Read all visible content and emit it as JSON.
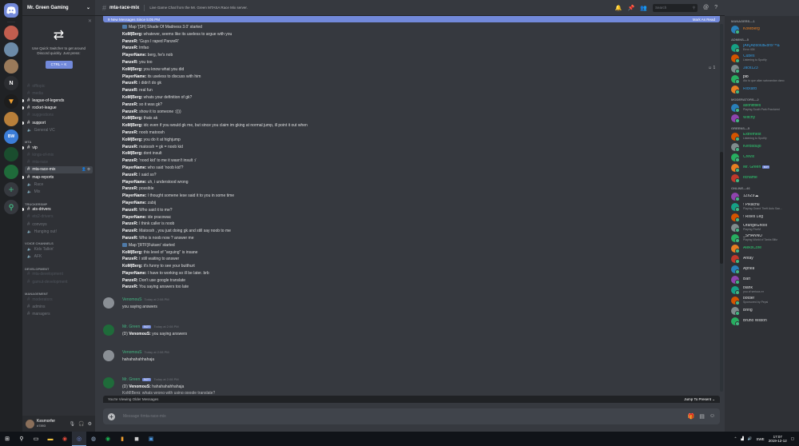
{
  "server": {
    "name": "Mr. Green Gaming",
    "quick_switcher": {
      "text": "Use Quick Switcher to get around Discord quickly. Just press:",
      "shortcut": "CTRL + K"
    }
  },
  "guild_letter": "N",
  "guild_bw": "BW",
  "channels": [
    {
      "type": "channel",
      "name": "offtopic",
      "state": "muted"
    },
    {
      "type": "channel",
      "name": "media",
      "state": "muted"
    },
    {
      "type": "channel",
      "name": "league-of-legends",
      "state": "unread"
    },
    {
      "type": "channel",
      "name": "rocket-league",
      "state": "unread"
    },
    {
      "type": "channel",
      "name": "suggestions",
      "state": "muted"
    },
    {
      "type": "channel",
      "name": "support",
      "state": "unread"
    },
    {
      "type": "voice",
      "name": "General VC",
      "state": "normal"
    },
    {
      "type": "category",
      "name": "MTA"
    },
    {
      "type": "channel",
      "name": "vip",
      "state": "unread"
    },
    {
      "type": "channel",
      "name": "kings-of-mix",
      "state": "muted"
    },
    {
      "type": "channel",
      "name": "mta-race",
      "state": "muted"
    },
    {
      "type": "channel",
      "name": "mta-race-mix",
      "state": "selected"
    },
    {
      "type": "channel",
      "name": "map-reports",
      "state": "unread"
    },
    {
      "type": "voice",
      "name": "Race",
      "state": "normal"
    },
    {
      "type": "voice",
      "name": "Mix",
      "state": "normal"
    },
    {
      "type": "category",
      "name": "TRUCKERSMP"
    },
    {
      "type": "channel",
      "name": "ats-drivers",
      "state": "unread"
    },
    {
      "type": "channel",
      "name": "ets2-drivers",
      "state": "muted"
    },
    {
      "type": "channel",
      "name": "convoys",
      "state": "normal"
    },
    {
      "type": "voice",
      "name": "Hanging out!",
      "state": "normal"
    },
    {
      "type": "category",
      "name": "VOICE CHANNELS"
    },
    {
      "type": "voice",
      "name": "Kids Talkin'",
      "state": "normal"
    },
    {
      "type": "voice",
      "name": "AFK",
      "state": "normal"
    },
    {
      "type": "category",
      "name": "DEVELOPMENT"
    },
    {
      "type": "channel",
      "name": "mta-development",
      "state": "muted"
    },
    {
      "type": "channel",
      "name": "gamut-development",
      "state": "muted"
    },
    {
      "type": "category",
      "name": "MANAGEMENT"
    },
    {
      "type": "channel",
      "name": "moderators",
      "state": "muted"
    },
    {
      "type": "channel",
      "name": "admins",
      "state": "normal"
    },
    {
      "type": "channel",
      "name": "managers",
      "state": "normal"
    }
  ],
  "user": {
    "name": "Kesmorfer",
    "tag": "#7893"
  },
  "chat": {
    "channel": "mta-race-mix",
    "topic": "Live Game Chat from the Mr. Green MTASA Race Mix server.",
    "search_placeholder": "Search",
    "new_messages": "9 New Messages Since 5:05 PM",
    "mark_as_read": "Mark As Read",
    "reaction": "1",
    "log": [
      {
        "emoji": true,
        "author": "",
        "text": "Map '[SH] Shade Of Madness 3.0' started"
      },
      {
        "author": "KoM|Berg:",
        "text": " whatever, seems like its useless to argue with you"
      },
      {
        "author": "PanzeR:",
        "text": " 'Guys I raped PanzeR'"
      },
      {
        "author": "PanzeR:",
        "text": " lmfao"
      },
      {
        "author": "PlayerName:",
        "text": " berg, he's nob"
      },
      {
        "author": "PanzeR:",
        "text": " you too"
      },
      {
        "author": "KoM|Berg:",
        "text": " you know what you did"
      },
      {
        "author": "PlayerName:",
        "text": " its useless to discuss with him"
      },
      {
        "author": "PanzeR:",
        "text": " i didn't do gk"
      },
      {
        "author": "PanzeR:",
        "text": " real fun"
      },
      {
        "author": "KoM|Berg:",
        "text": " whats your definition of gk?"
      },
      {
        "author": "PanzeR:",
        "text": " so it was gk?"
      },
      {
        "author": "PanzeR:",
        "text": " show it to someone :()))"
      },
      {
        "author": "KoM|Berg:",
        "text": " thats ak"
      },
      {
        "author": "KoM|Berg:",
        "text": " idc even if you would gk me, but since you claim im gking at normal jump, ill point it out when"
      },
      {
        "author": "PanzeR:",
        "text": " noob matoosh"
      },
      {
        "author": "KoM|Berg:",
        "text": " you do it at highjump"
      },
      {
        "author": "PanzeR:",
        "text": " matoosh = gk = noob kid"
      },
      {
        "author": "KoM|Berg:",
        "text": " dont insult"
      },
      {
        "author": "PanzeR:",
        "text": " 'nood kid' to me it wasn't insult :/"
      },
      {
        "author": "PlayerName:",
        "text": " who said 'noob kid'?"
      },
      {
        "author": "PanzeR:",
        "text": " I said so?"
      },
      {
        "author": "PlayerName:",
        "text": " uh, i understood wrong"
      },
      {
        "author": "PanzeR:",
        "text": " possible"
      },
      {
        "author": "PlayerName:",
        "text": " I thought somene lese said it to you in some time"
      },
      {
        "author": "PlayerName:",
        "text": " zabij"
      },
      {
        "author": "PanzeR:",
        "text": " Who said it to me?"
      },
      {
        "author": "PlayerName:",
        "text": " ide pracowac"
      },
      {
        "author": "PanzeR:",
        "text": " I think caller is noob"
      },
      {
        "author": "PanzeR:",
        "text": " Matoosh , you just doing gk and still say noob to me"
      },
      {
        "author": "PanzeR:",
        "text": " Who is noob now ? answer me"
      },
      {
        "emoji": true,
        "author": "",
        "text": "Map '[RTF]Fukaro' started"
      },
      {
        "author": "KoM|Berg:",
        "text": " this level of \"arguing\" is insane"
      },
      {
        "author": "PanzeR:",
        "text": " I still waiting to answer"
      },
      {
        "author": "KoM|Berg:",
        "text": " it's funny to see your butthurt"
      },
      {
        "author": "PlayerName:",
        "text": " I have to working so ill be later. brb"
      },
      {
        "author": "PanzeR:",
        "text": " Don't use google translate"
      },
      {
        "author": "PanzeR:",
        "text": " You saying answers too late"
      }
    ],
    "messages": [
      {
        "name": "VenomouS",
        "time": "Today at 2:08 PM",
        "body": "you saying answers"
      },
      {
        "name": "Mr. Green",
        "bot": "BOT",
        "time": "Today at 2:08 PM",
        "body_prefix": "(D) ",
        "body_author": "VenomouS:",
        "body": " you saying answers"
      },
      {
        "name": "VenomouS",
        "time": "Today at 2:08 PM",
        "body": "hahahahahhahaja"
      },
      {
        "name": "Mr. Green",
        "bot": "BOT",
        "time": "Today at 2:08 PM",
        "body_prefix": "(D) ",
        "body_author": "VenomouS:",
        "body": " hahahahahhahaja",
        "body2": "KoM|Berg: whats wrong with using google translate?"
      }
    ],
    "older_messages": "You're Viewing Older Messages",
    "jump_to_present": "Jump To Present",
    "composer_placeholder": "Message #mta-race-mix"
  },
  "members": [
    {
      "type": "category",
      "label": "MANAGERS—1"
    },
    {
      "name": "KoMBerg",
      "color": "#e67e22",
      "status": ""
    },
    {
      "type": "category",
      "label": "ADMINS—5"
    },
    {
      "name": "[AK]AbsolutEbrix™&",
      "color": "#3498db",
      "status": "Error 404"
    },
    {
      "name": "Cubes",
      "color": "#3498db",
      "status": "Listening to Spotify"
    },
    {
      "name": "Jack123",
      "color": "#3498db",
      "status": ""
    },
    {
      "name": "pio",
      "color": "#ffffff",
      "status": "Ato to que allan saturandan dano"
    },
    {
      "name": "Rickard",
      "color": "#3498db",
      "status": ""
    },
    {
      "type": "category",
      "label": "MODERATORS—2"
    },
    {
      "name": "asonitities",
      "color": "#2ecc71",
      "status": "Playing South Park:Fractured"
    },
    {
      "name": "Witchy",
      "color": "#2ecc71",
      "status": ""
    },
    {
      "type": "category",
      "label": "GREENS—5"
    },
    {
      "name": "Extremest",
      "color": "#2ecc71",
      "status": "Listening to Spotify"
    },
    {
      "name": "Kerbsdujo",
      "color": "#2ecc71",
      "status": ""
    },
    {
      "name": "Crevix",
      "color": "#2ecc71",
      "status": ""
    },
    {
      "name": "Mr. Green",
      "color": "#2ecc71",
      "status": "",
      "bot": "BOT"
    },
    {
      "name": "Itchame",
      "color": "#2ecc71",
      "status": ""
    },
    {
      "type": "category",
      "label": "ONLINE—46"
    },
    {
      "name": "1Z6Z9☁",
      "color": "#dcddde",
      "status": ""
    },
    {
      "name": "! Pikachu",
      "color": "#dcddde",
      "status": "Playing Grand Theft Auto San..."
    },
    {
      "name": "! Rises Leg",
      "color": "#dcddde",
      "status": ""
    },
    {
      "name": "OrangeGhost",
      "color": "#dcddde",
      "status": "Playing FiveM"
    },
    {
      "name": "_SHANNU",
      "color": "#dcddde",
      "status": "Playing World of Tanks Blitz"
    },
    {
      "name": "AleksCore",
      "color": "#2ecc71",
      "status": ""
    },
    {
      "name": "Antay",
      "color": "#dcddde",
      "status": ""
    },
    {
      "name": "Apnea",
      "color": "#dcddde",
      "status": ""
    },
    {
      "name": "Bart",
      "color": "#dcddde",
      "status": ""
    },
    {
      "name": "blank",
      "color": "#dcddde",
      "status": "you of serious er"
    },
    {
      "name": "botder",
      "color": "#dcddde",
      "status": "Sponsored by Pepsi"
    },
    {
      "name": "Bring",
      "color": "#dcddde",
      "status": ""
    },
    {
      "name": "Bruno Wilson",
      "color": "#dcddde",
      "status": ""
    }
  ],
  "taskbar": {
    "lang": "SWE",
    "time": "17:07",
    "date": "2019-12-12"
  }
}
